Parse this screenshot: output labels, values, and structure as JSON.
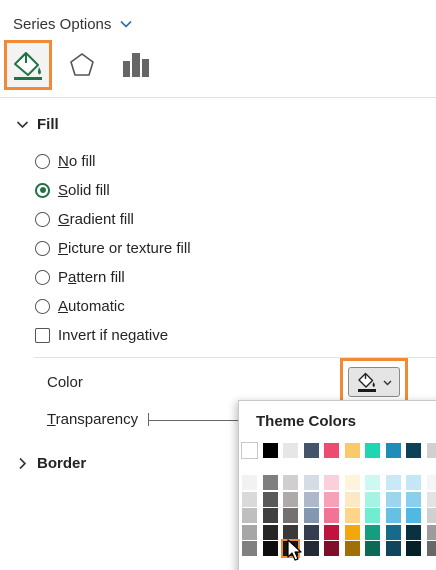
{
  "header": {
    "title": "Series Options"
  },
  "tabs": [
    {
      "name": "fill-line",
      "icon": "paint-bucket-icon",
      "active": true
    },
    {
      "name": "effects",
      "icon": "pentagon-icon",
      "active": false
    },
    {
      "name": "series-options",
      "icon": "bar-chart-icon",
      "active": false
    }
  ],
  "fill": {
    "title": "Fill",
    "options": [
      {
        "label": "No fill",
        "type": "radio",
        "checked": false
      },
      {
        "label": "Solid fill",
        "type": "radio",
        "checked": true
      },
      {
        "label": "Gradient fill",
        "type": "radio",
        "checked": false
      },
      {
        "label": "Picture or texture fill",
        "type": "radio",
        "checked": false
      },
      {
        "label": "Pattern fill",
        "type": "radio",
        "checked": false
      },
      {
        "label": "Automatic",
        "type": "radio",
        "checked": false
      },
      {
        "label": "Invert if negative",
        "type": "checkbox",
        "checked": false
      }
    ],
    "color_label": "Color",
    "transparency_label": "Transparency",
    "color_button": {
      "icon": "paint-bucket-icon",
      "dropdown_icon": "chevron-down-icon",
      "current_color": "#1a1a1a"
    }
  },
  "border": {
    "title": "Border"
  },
  "theme_colors": {
    "title": "Theme Colors",
    "top_row": [
      "#ffffff",
      "#000000",
      "#e7e6e6",
      "#44546a",
      "#ee4a72",
      "#f9c96a",
      "#1ed7b0",
      "#1f8db8",
      "#0c4258",
      "#d0d0d0"
    ],
    "shades": [
      [
        "#f2f2f2",
        "#d9d9d9",
        "#bfbfbf",
        "#a6a6a6",
        "#808080"
      ],
      [
        "#7f7f7f",
        "#595959",
        "#404040",
        "#262626",
        "#0d0d0d"
      ],
      [
        "#d0cece",
        "#aeaaaa",
        "#757171",
        "#3b3838",
        "#171616"
      ],
      [
        "#d6dce5",
        "#adb9ca",
        "#8497b0",
        "#333f50",
        "#222a35"
      ],
      [
        "#fbd0dc",
        "#f7a1b8",
        "#f37395",
        "#c0143e",
        "#800d29"
      ],
      [
        "#fef3dd",
        "#fde8c4",
        "#fcd48a",
        "#f4a60d",
        "#a26e06"
      ],
      [
        "#ccfaf0",
        "#a5f3e2",
        "#71ecd1",
        "#139e80",
        "#0c6955"
      ],
      [
        "#c9e9f6",
        "#9cd5ed",
        "#66c0e4",
        "#176a8a",
        "#0f465c"
      ],
      [
        "#c4e7f6",
        "#8ad0ec",
        "#50b9e3",
        "#09313f",
        "#06202a"
      ],
      [
        "#f5f5f5",
        "#e3e3e3",
        "#d0d0d0",
        "#9c9c9c",
        "#686868"
      ]
    ],
    "selected": {
      "column": 2,
      "row": 4
    }
  }
}
